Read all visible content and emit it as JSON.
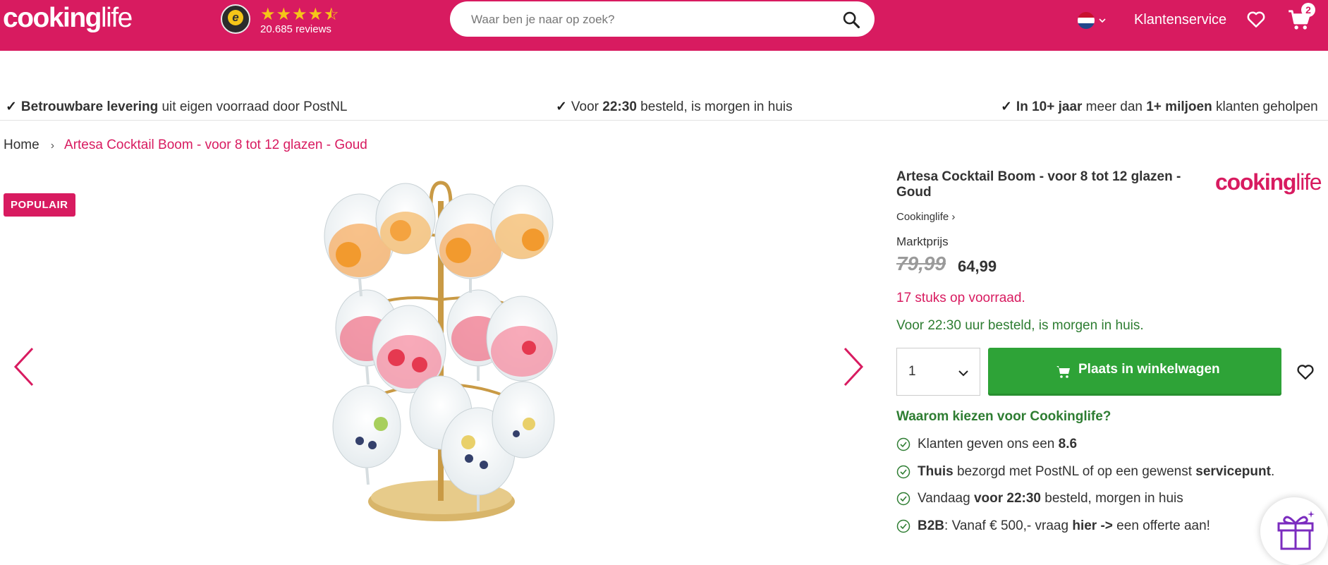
{
  "header": {
    "logo_bold": "cooking",
    "logo_light": "life",
    "rating_stars": 4.5,
    "reviews_count": "20.685",
    "reviews_label": "reviews",
    "search_placeholder": "Waar ben je naar op zoek?",
    "customer_service": "Klantenservice",
    "cart_count": "2"
  },
  "usp_bar": [
    {
      "bold": "Betrouwbare levering",
      "rest": " uit eigen voorraad door PostNL"
    },
    {
      "pre": "Voor ",
      "bold": "22:30",
      "rest": " besteld, is morgen in huis"
    },
    {
      "bold": "In 10+ jaar",
      "mid": " meer dan ",
      "bold2": "1+ miljoen",
      "rest": " klanten geholpen"
    }
  ],
  "breadcrumb": {
    "home": "Home",
    "current": "Artesa Cocktail Boom - voor 8 tot 12 glazen - Goud"
  },
  "gallery": {
    "badge": "POPULAIR"
  },
  "product": {
    "title": "Artesa Cocktail Boom - voor 8 tot 12 glazen - Goud",
    "brand_logo_bold": "cooking",
    "brand_logo_light": "life",
    "brand_link": "Cookinglife ›",
    "market_label": "Marktprijs",
    "old_price": "79,99",
    "new_price": "64,99",
    "stock": "17 stuks op voorraad.",
    "delivery": "Voor 22:30 uur besteld, is morgen in huis.",
    "quantity": "1",
    "add_to_cart": "Plaats in winkelwagen"
  },
  "why": {
    "title": "Waarom kiezen voor Cookinglife?",
    "items": [
      {
        "a": "Klanten geven ons een ",
        "b": "8.6",
        "c": ""
      },
      {
        "a": "",
        "b": "Thuis",
        "c": " bezorgd met PostNL of op een gewenst ",
        "d": "servicepunt",
        "e": "."
      },
      {
        "a": "Vandaag ",
        "b": "voor 22:30",
        "c": " besteld, morgen in huis"
      },
      {
        "a": "",
        "b": "B2B",
        "c": ": Vanaf € 500,- vraag ",
        "d": "hier ->",
        "e": " een offerte aan!"
      }
    ]
  },
  "colors": {
    "brand": "#d81b60",
    "cta": "#2ea337",
    "positive": "#2e7d32"
  }
}
